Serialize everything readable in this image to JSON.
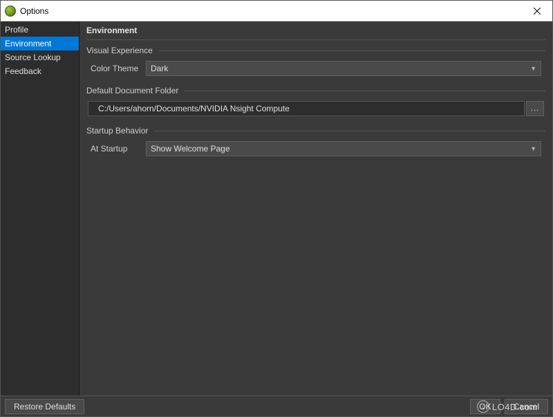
{
  "window": {
    "title": "Options"
  },
  "sidebar": {
    "items": [
      {
        "label": "Profile",
        "selected": false
      },
      {
        "label": "Environment",
        "selected": true
      },
      {
        "label": "Source Lookup",
        "selected": false
      },
      {
        "label": "Feedback",
        "selected": false
      }
    ]
  },
  "page": {
    "title": "Environment",
    "groups": {
      "visual_experience": {
        "title": "Visual Experience",
        "color_theme": {
          "label": "Color Theme",
          "value": "Dark"
        }
      },
      "default_document_folder": {
        "title": "Default Document Folder",
        "path": "C:/Users/ahorn/Documents/NVIDIA Nsight Compute",
        "browse_label": "..."
      },
      "startup_behavior": {
        "title": "Startup Behavior",
        "at_startup": {
          "label": "At Startup",
          "value": "Show Welcome Page"
        }
      }
    }
  },
  "footer": {
    "restore_defaults": "Restore Defaults",
    "ok": "OK",
    "cancel": "Cancel"
  },
  "watermark": {
    "text": "LO4D.com"
  }
}
